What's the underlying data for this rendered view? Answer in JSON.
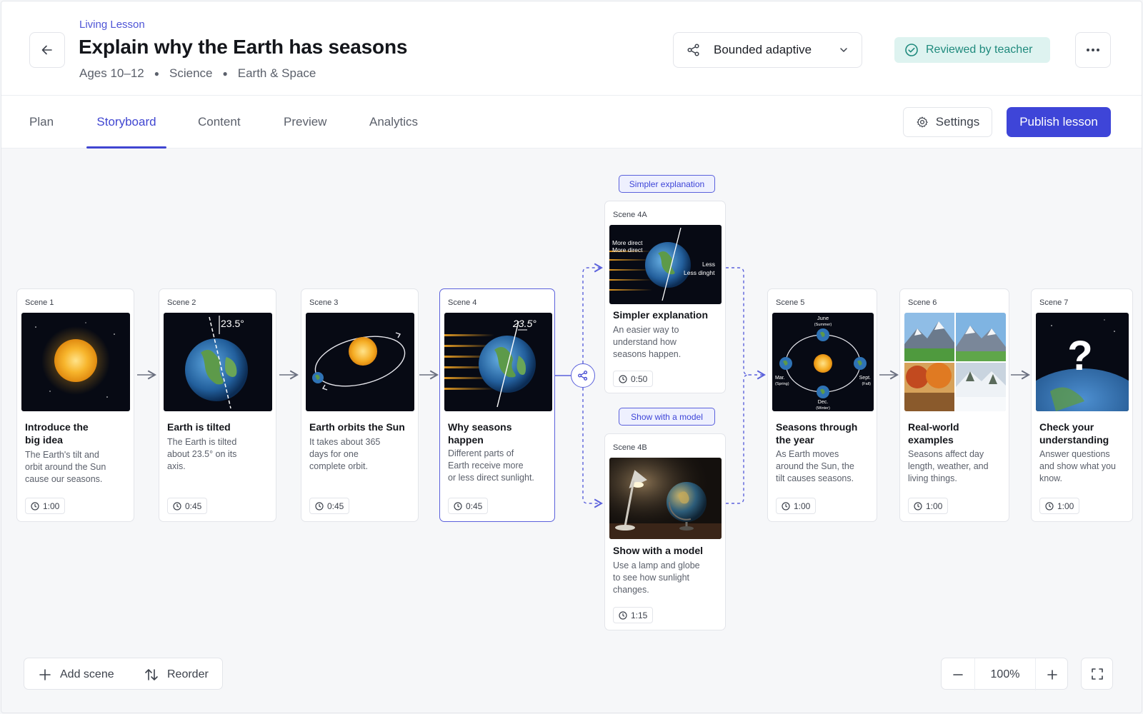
{
  "header": {
    "eyebrow": "Living Lesson",
    "title": "Explain why the Earth has seasons",
    "meta": [
      "Ages 10–12",
      "Science",
      "Earth & Space"
    ],
    "mode": "Bounded adaptive",
    "status_badge": "Reviewed by teacher"
  },
  "tabs": [
    "Plan",
    "Storyboard",
    "Content",
    "Preview",
    "Analytics"
  ],
  "active_tab": "Storyboard",
  "actions": {
    "settings": "Settings",
    "publish": "Publish lesson"
  },
  "colors": {
    "accent": "#3e45d8",
    "badge_bg": "#def3f0",
    "badge_text": "#1f8a7d"
  },
  "scenes": [
    {
      "label": "Scene 1",
      "title_1": "Introduce the",
      "title_2": "big idea",
      "desc_1": "The Earth's tilt and",
      "desc_2": "orbit around the Sun",
      "desc_3": "cause our seasons.",
      "duration": "1:00",
      "image": "glowing-sun"
    },
    {
      "label": "Scene 2",
      "title_1": "Earth is tilted",
      "desc_1": "The Earth is tilted",
      "desc_2": "about 23.5° on its",
      "desc_3": "axis.",
      "duration": "0:45",
      "image": "tilted-earth",
      "thumb_text": "23.5°"
    },
    {
      "label": "Scene 3",
      "title_1": "Earth orbits the Sun",
      "desc_1": "It takes about 365",
      "desc_2": "days for one",
      "desc_3": "complete orbit.",
      "duration": "0:45",
      "image": "earth-orbit"
    },
    {
      "label": "Scene 4",
      "title_1": "Why seasons",
      "title_2": "happen",
      "desc_1": "Different parts of",
      "desc_2": "Earth receive more",
      "desc_3": "or less direct sunlight.",
      "duration": "0:45",
      "image": "sunlight-on-earth",
      "thumb_text": "23.5°"
    },
    {
      "label": "Scene 5",
      "title_1": "Seasons through",
      "title_2": "the year",
      "desc_1": "As Earth moves",
      "desc_2": "around the Sun, the",
      "desc_3": "tilt causes seasons.",
      "duration": "1:00",
      "image": "seasons-diagram",
      "thumb_labels": {
        "top_1": "June",
        "top_2": "(Summer)",
        "left_1": "Mar.",
        "left_2": "(Spring)",
        "right_1": "Sept.",
        "right_2": "(Fall)",
        "bottom_1": "Dec.",
        "bottom_2": "(Winter)"
      }
    },
    {
      "label": "Scene 6",
      "title_1": "Real-world",
      "title_2": "examples",
      "desc_1": "Seasons affect day",
      "desc_2": "length, weather, and",
      "desc_3": "living things.",
      "duration": "1:00",
      "image": "four-season-landscapes"
    },
    {
      "label": "Scene 7",
      "title_1": "Check your",
      "title_2": "understanding",
      "desc_1": "Answer questions",
      "desc_2": "and show what you",
      "desc_3": "know.",
      "duration": "1:00",
      "image": "question-earth",
      "thumb_text": "?"
    }
  ],
  "branches": [
    {
      "pill": "Simpler explanation",
      "label": "Scene 4A",
      "title": "Simpler explanation",
      "desc_1": "An easier way to",
      "desc_2": "understand how",
      "desc_3": "seasons happen.",
      "duration": "0:50",
      "image": "direct-indirect-light",
      "thumb_labels": {
        "left_1": "More direct",
        "left_2": "More direct",
        "right_1": "Less",
        "right_2": "Less dinght"
      }
    },
    {
      "pill": "Show with a model",
      "label": "Scene 4B",
      "title": "Show with a model",
      "desc_1": "Use a lamp and globe",
      "desc_2": "to see how sunlight",
      "desc_3": "changes.",
      "duration": "1:15",
      "image": "lamp-and-globe"
    }
  ],
  "toolbar": {
    "add_scene": "Add scene",
    "reorder": "Reorder",
    "zoom": "100%"
  }
}
